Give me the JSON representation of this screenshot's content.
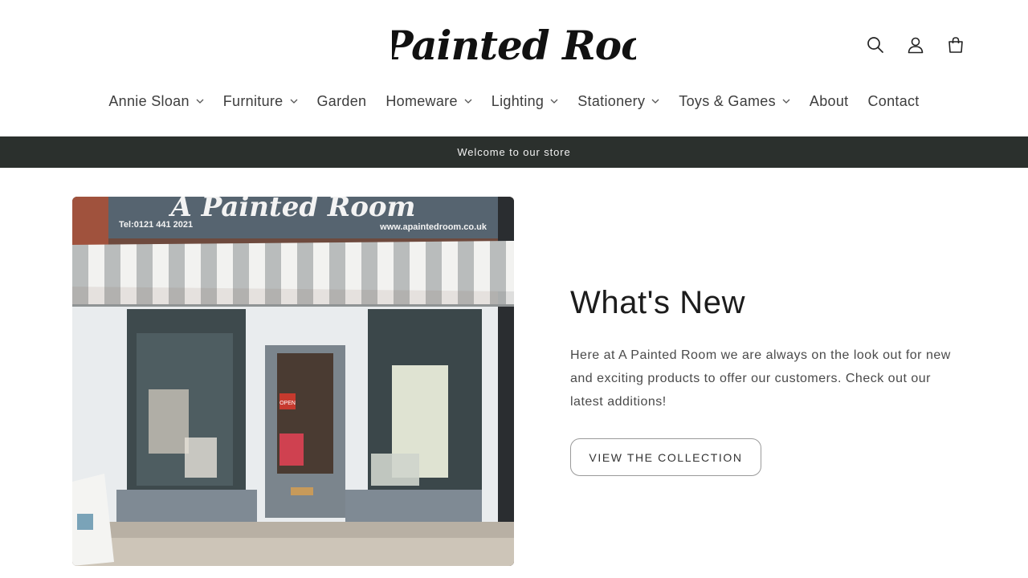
{
  "brand": {
    "logo_text": "A Painted Room"
  },
  "header": {
    "icons": [
      "search-icon",
      "account-icon",
      "cart-icon"
    ]
  },
  "nav": {
    "items": [
      {
        "label": "Annie Sloan",
        "dropdown": true
      },
      {
        "label": "Furniture",
        "dropdown": true
      },
      {
        "label": "Garden",
        "dropdown": false
      },
      {
        "label": "Homeware",
        "dropdown": true
      },
      {
        "label": "Lighting",
        "dropdown": true
      },
      {
        "label": "Stationery",
        "dropdown": true
      },
      {
        "label": "Toys & Games",
        "dropdown": true
      },
      {
        "label": "About",
        "dropdown": false
      },
      {
        "label": "Contact",
        "dropdown": false
      }
    ]
  },
  "announcement": {
    "text": "Welcome to our store",
    "background": "#2b302d"
  },
  "hero": {
    "image": {
      "sign_text": "A Painted Room",
      "phone": "Tel:0121 441 2021",
      "website": "www.apaintedroom.co.uk",
      "door_sign": "OPEN"
    },
    "title": "What's New",
    "body": "Here at A Painted Room we are always on the look out for new and exciting products to offer our customers. Check out our latest additions!",
    "button_label": "VIEW THE COLLECTION"
  }
}
